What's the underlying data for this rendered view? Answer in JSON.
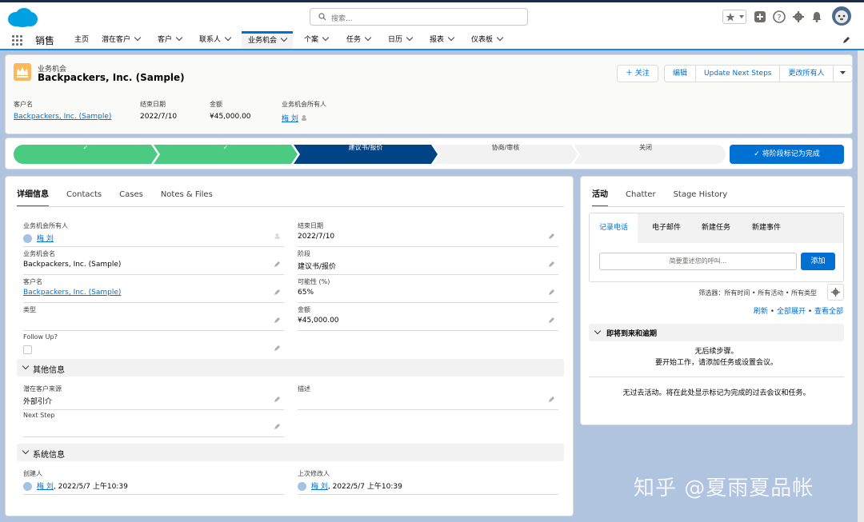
{
  "header": {
    "search_placeholder": "搜索..."
  },
  "nav": {
    "app_name": "销售",
    "items": [
      {
        "label": "主页",
        "has_menu": false
      },
      {
        "label": "潜在客户",
        "has_menu": true
      },
      {
        "label": "客户",
        "has_menu": true
      },
      {
        "label": "联系人",
        "has_menu": true
      },
      {
        "label": "业务机会",
        "has_menu": true,
        "active": true
      },
      {
        "label": "个案",
        "has_menu": true
      },
      {
        "label": "任务",
        "has_menu": true
      },
      {
        "label": "日历",
        "has_menu": true
      },
      {
        "label": "报表",
        "has_menu": true
      },
      {
        "label": "仪表板",
        "has_menu": true
      }
    ]
  },
  "record": {
    "object_type": "业务机会",
    "title": "Backpackers, Inc. (Sample)",
    "buttons": {
      "follow": "关注",
      "edit": "编辑",
      "update_next_steps": "Update Next Steps",
      "change_owner": "更改所有人"
    },
    "highlights": [
      {
        "label": "客户名",
        "value": "Backpackers, Inc. (Sample)",
        "link": true
      },
      {
        "label": "结束日期",
        "value": "2022/7/10",
        "link": false
      },
      {
        "label": "金额",
        "value": "¥45,000.00",
        "link": false
      },
      {
        "label": "业务机会所有人",
        "value": "梅 刘",
        "link": true
      }
    ]
  },
  "path": {
    "stages": [
      {
        "label": "✓",
        "status": "complete"
      },
      {
        "label": "✓",
        "status": "complete"
      },
      {
        "label": "建议书/报价",
        "status": "current"
      },
      {
        "label": "协商/审核",
        "status": "incomplete"
      },
      {
        "label": "关闭",
        "status": "incomplete"
      }
    ],
    "mark_button": "将阶段标记为完成",
    "colors": {
      "complete": "#4bca81",
      "current": "#014486",
      "incomplete": "#f3f2f2"
    }
  },
  "details": {
    "tabs": [
      "详细信息",
      "Contacts",
      "Cases",
      "Notes & Files"
    ],
    "fields_left": [
      {
        "label": "业务机会所有人",
        "value": "梅 刘",
        "link": true,
        "user": true
      },
      {
        "label": "业务机会名",
        "value": "Backpackers, Inc. (Sample)",
        "link": false
      },
      {
        "label": "客户名",
        "value": "Backpackers, Inc. (Sample)",
        "link": true
      },
      {
        "label": "类型",
        "value": "",
        "link": false
      },
      {
        "label": "Follow Up?",
        "value": "",
        "link": false,
        "checkbox": true
      }
    ],
    "fields_right": [
      {
        "label": "结束日期",
        "value": "2022/7/10",
        "link": false
      },
      {
        "label": "阶段",
        "value": "建议书/报价",
        "link": false
      },
      {
        "label": "可能性 (%)",
        "value": "65%",
        "link": false
      },
      {
        "label": "金额",
        "value": "¥45,000.00",
        "link": false
      }
    ],
    "section_other": "其他信息",
    "other_left": [
      {
        "label": "潜在客户来源",
        "value": "外部引介"
      },
      {
        "label": "Next Step",
        "value": ""
      }
    ],
    "other_right": [
      {
        "label": "描述",
        "value": ""
      }
    ],
    "section_system": "系统信息",
    "created_by": {
      "label": "创建人",
      "user": "梅 刘",
      "date": ", 2022/5/7 上午10:39"
    },
    "modified_by": {
      "label": "上次修改人",
      "user": "梅 刘",
      "date": ", 2022/5/7 上午10:39"
    }
  },
  "activity": {
    "tabs": [
      "活动",
      "Chatter",
      "Stage History"
    ],
    "subtabs": [
      "记录电话",
      "电子邮件",
      "新建任务",
      "新建事件"
    ],
    "call_placeholder": "简要重述您的呼叫...",
    "add_button": "添加",
    "filter_text": "筛选器：所有时间 • 所有活动 • 所有类型",
    "link_refresh": "刷新",
    "link_expand": "全部展开",
    "link_viewall": "查看全部",
    "upcoming_title": "即将到来和逾期",
    "no_next_steps_1": "无后续步骤。",
    "no_next_steps_2": "要开始工作，请添加任务或设置会议。",
    "no_past": "无过去活动。将在此处显示标记为完成的过去会议和任务。"
  },
  "watermark": "知乎 @夏雨夏品帐"
}
